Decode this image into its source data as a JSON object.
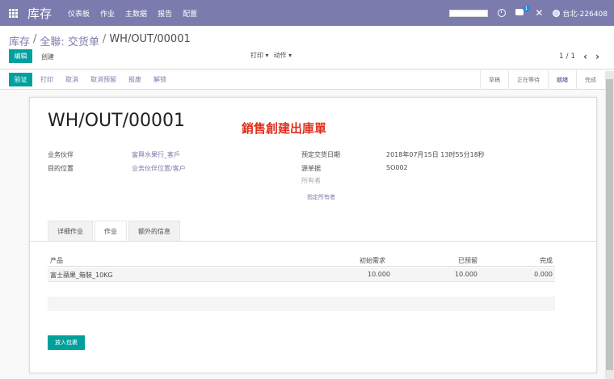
{
  "navbar": {
    "app_name": "库存",
    "menu": [
      "仪表板",
      "作业",
      "主数据",
      "报告",
      "配置"
    ],
    "message_badge": "1",
    "user_name": "台北-226408"
  },
  "control": {
    "breadcrumb": [
      "库存",
      "全聯: 交货单",
      "WH/OUT/00001"
    ],
    "edit_label": "编辑",
    "create_label": "创建",
    "print_label": "打印 ▾",
    "action_label": "动作 ▾",
    "pager": "1 / 1"
  },
  "actions": {
    "validate": "验证",
    "items": [
      "打印",
      "取消",
      "取消预留",
      "报废",
      "解锁"
    ]
  },
  "stages": [
    {
      "label": "草稿",
      "active": false
    },
    {
      "label": "正在等待",
      "active": false
    },
    {
      "label": "就绪",
      "active": true
    },
    {
      "label": "完成",
      "active": false
    }
  ],
  "sheet": {
    "title": "WH/OUT/00001",
    "annotation": "銷售創建出庫單",
    "partner_label": "业务伙伴",
    "partner_value": "富興水果行_客戶",
    "dest_label": "目的位置",
    "dest_value": "业务伙伴位置/客户",
    "scheduled_label": "预定交货日期",
    "scheduled_value": "2018年07月15日 13时55分18秒",
    "source_label": "源单据",
    "source_value": "SO002",
    "owner_placeholder": "所有者",
    "assign_owner": "指定所有者",
    "tabs": [
      {
        "label": "详细作业",
        "active": false
      },
      {
        "label": "作业",
        "active": true
      },
      {
        "label": "额外的信息",
        "active": false
      }
    ],
    "table": {
      "headers": [
        "产品",
        "初始需求",
        "已预留",
        "完成"
      ],
      "rows": [
        [
          "富士蘋果_箱裝_10KG",
          "10.000",
          "10.000",
          "0.000"
        ]
      ]
    },
    "put_in_pack": "放入包裹"
  }
}
